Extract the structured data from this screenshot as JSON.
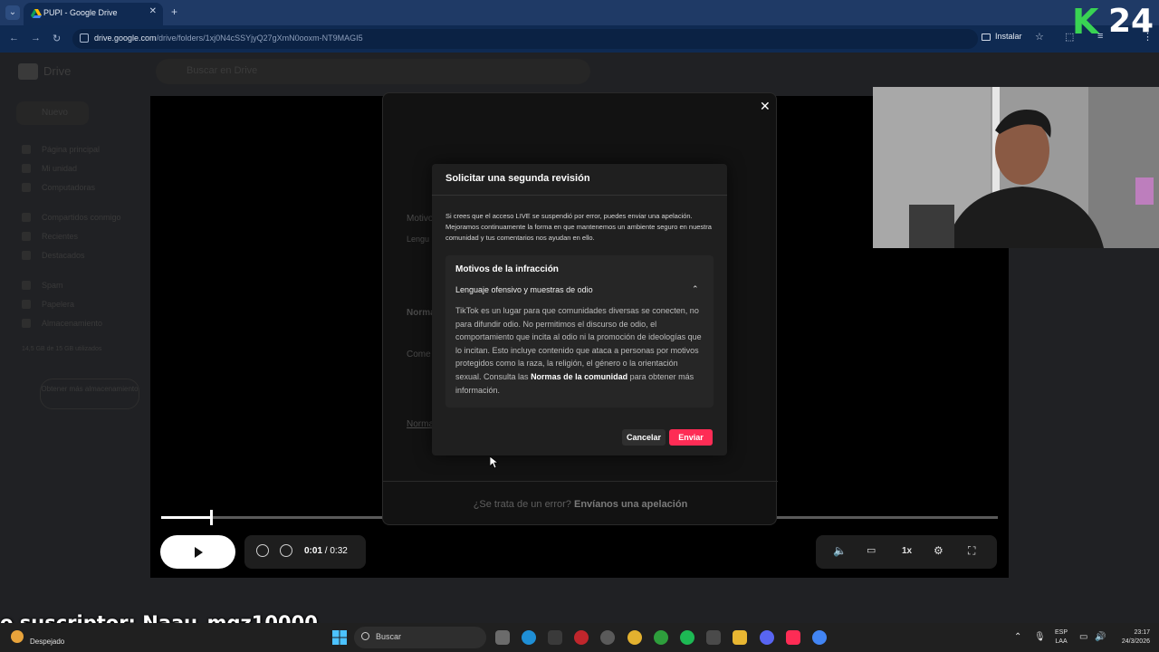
{
  "browser": {
    "tab_title": "PUPI - Google Drive",
    "url_host": "drive.google.com",
    "url_path": "/drive/folders/1xj0N4cSSYjyQ27gXmN0ooxm-NT9MAGI5",
    "install_label": "Instalar"
  },
  "drive": {
    "app_name": "Drive",
    "search_placeholder": "Buscar en Drive",
    "new_label": "Nuevo",
    "sidebar": [
      "Página principal",
      "Mi unidad",
      "Computadoras",
      "Compartidos conmigo",
      "Recientes",
      "Destacados",
      "Spam",
      "Papelera",
      "Almacenamiento"
    ],
    "storage_text": "14,5 GB de 15 GB utilizados",
    "get_storage_label": "Obtener más almacenamiento"
  },
  "player": {
    "time_current": "0:01",
    "time_separator": "/",
    "time_total": "0:32",
    "speed_label": "1x",
    "progress": 0.06
  },
  "tiktok_modal": {
    "ghost_motivos": "Motivo",
    "ghost_lengua": "Lengu",
    "ghost_norma": "Norma",
    "ghost_come": "Come",
    "ghost_norma2": "Norma",
    "appeal_question": "¿Se trata de un error?",
    "appeal_link": "Envíanos una apelación"
  },
  "dialog": {
    "title": "Solicitar una segunda revisión",
    "description": "Si crees que el acceso LIVE se suspendió por error, puedes enviar una apelación. Mejoramos continuamente la forma en que mantenemos un ambiente seguro en nuestra comunidad y tus comentarios nos ayudan en ello.",
    "reasons_title": "Motivos de la infracción",
    "reason_name": "Lenguaje ofensivo y muestras de odio",
    "reason_body": "TikTok es un lugar para que comunidades diversas se conecten, no para difundir odio. No permitimos el discurso de odio, el comportamiento que incita al odio ni la promoción de ideologías que lo incitan. Esto incluye contenido que ataca a personas por motivos protegidos como la raza, la religión, el género o la orientación sexual. Consulta las",
    "reason_link": "Normas de la comunidad",
    "reason_tail": "para obtener más información.",
    "cancel_label": "Cancelar",
    "send_label": "Enviar"
  },
  "overlay": {
    "logo_letter": "K",
    "logo_number": "24",
    "subscriber_banner": "o suscriptor: Naau_mqz10000"
  },
  "taskbar": {
    "weather_label": "Despejado",
    "search_label": "Buscar",
    "lang_top": "ESP",
    "lang_bottom": "LAA",
    "time": "23:17",
    "date": "24/3/2026"
  },
  "colors": {
    "tiktok_red": "#fe2c55",
    "k24_green": "#39d353",
    "chrome_blue": "#1f3a66"
  }
}
